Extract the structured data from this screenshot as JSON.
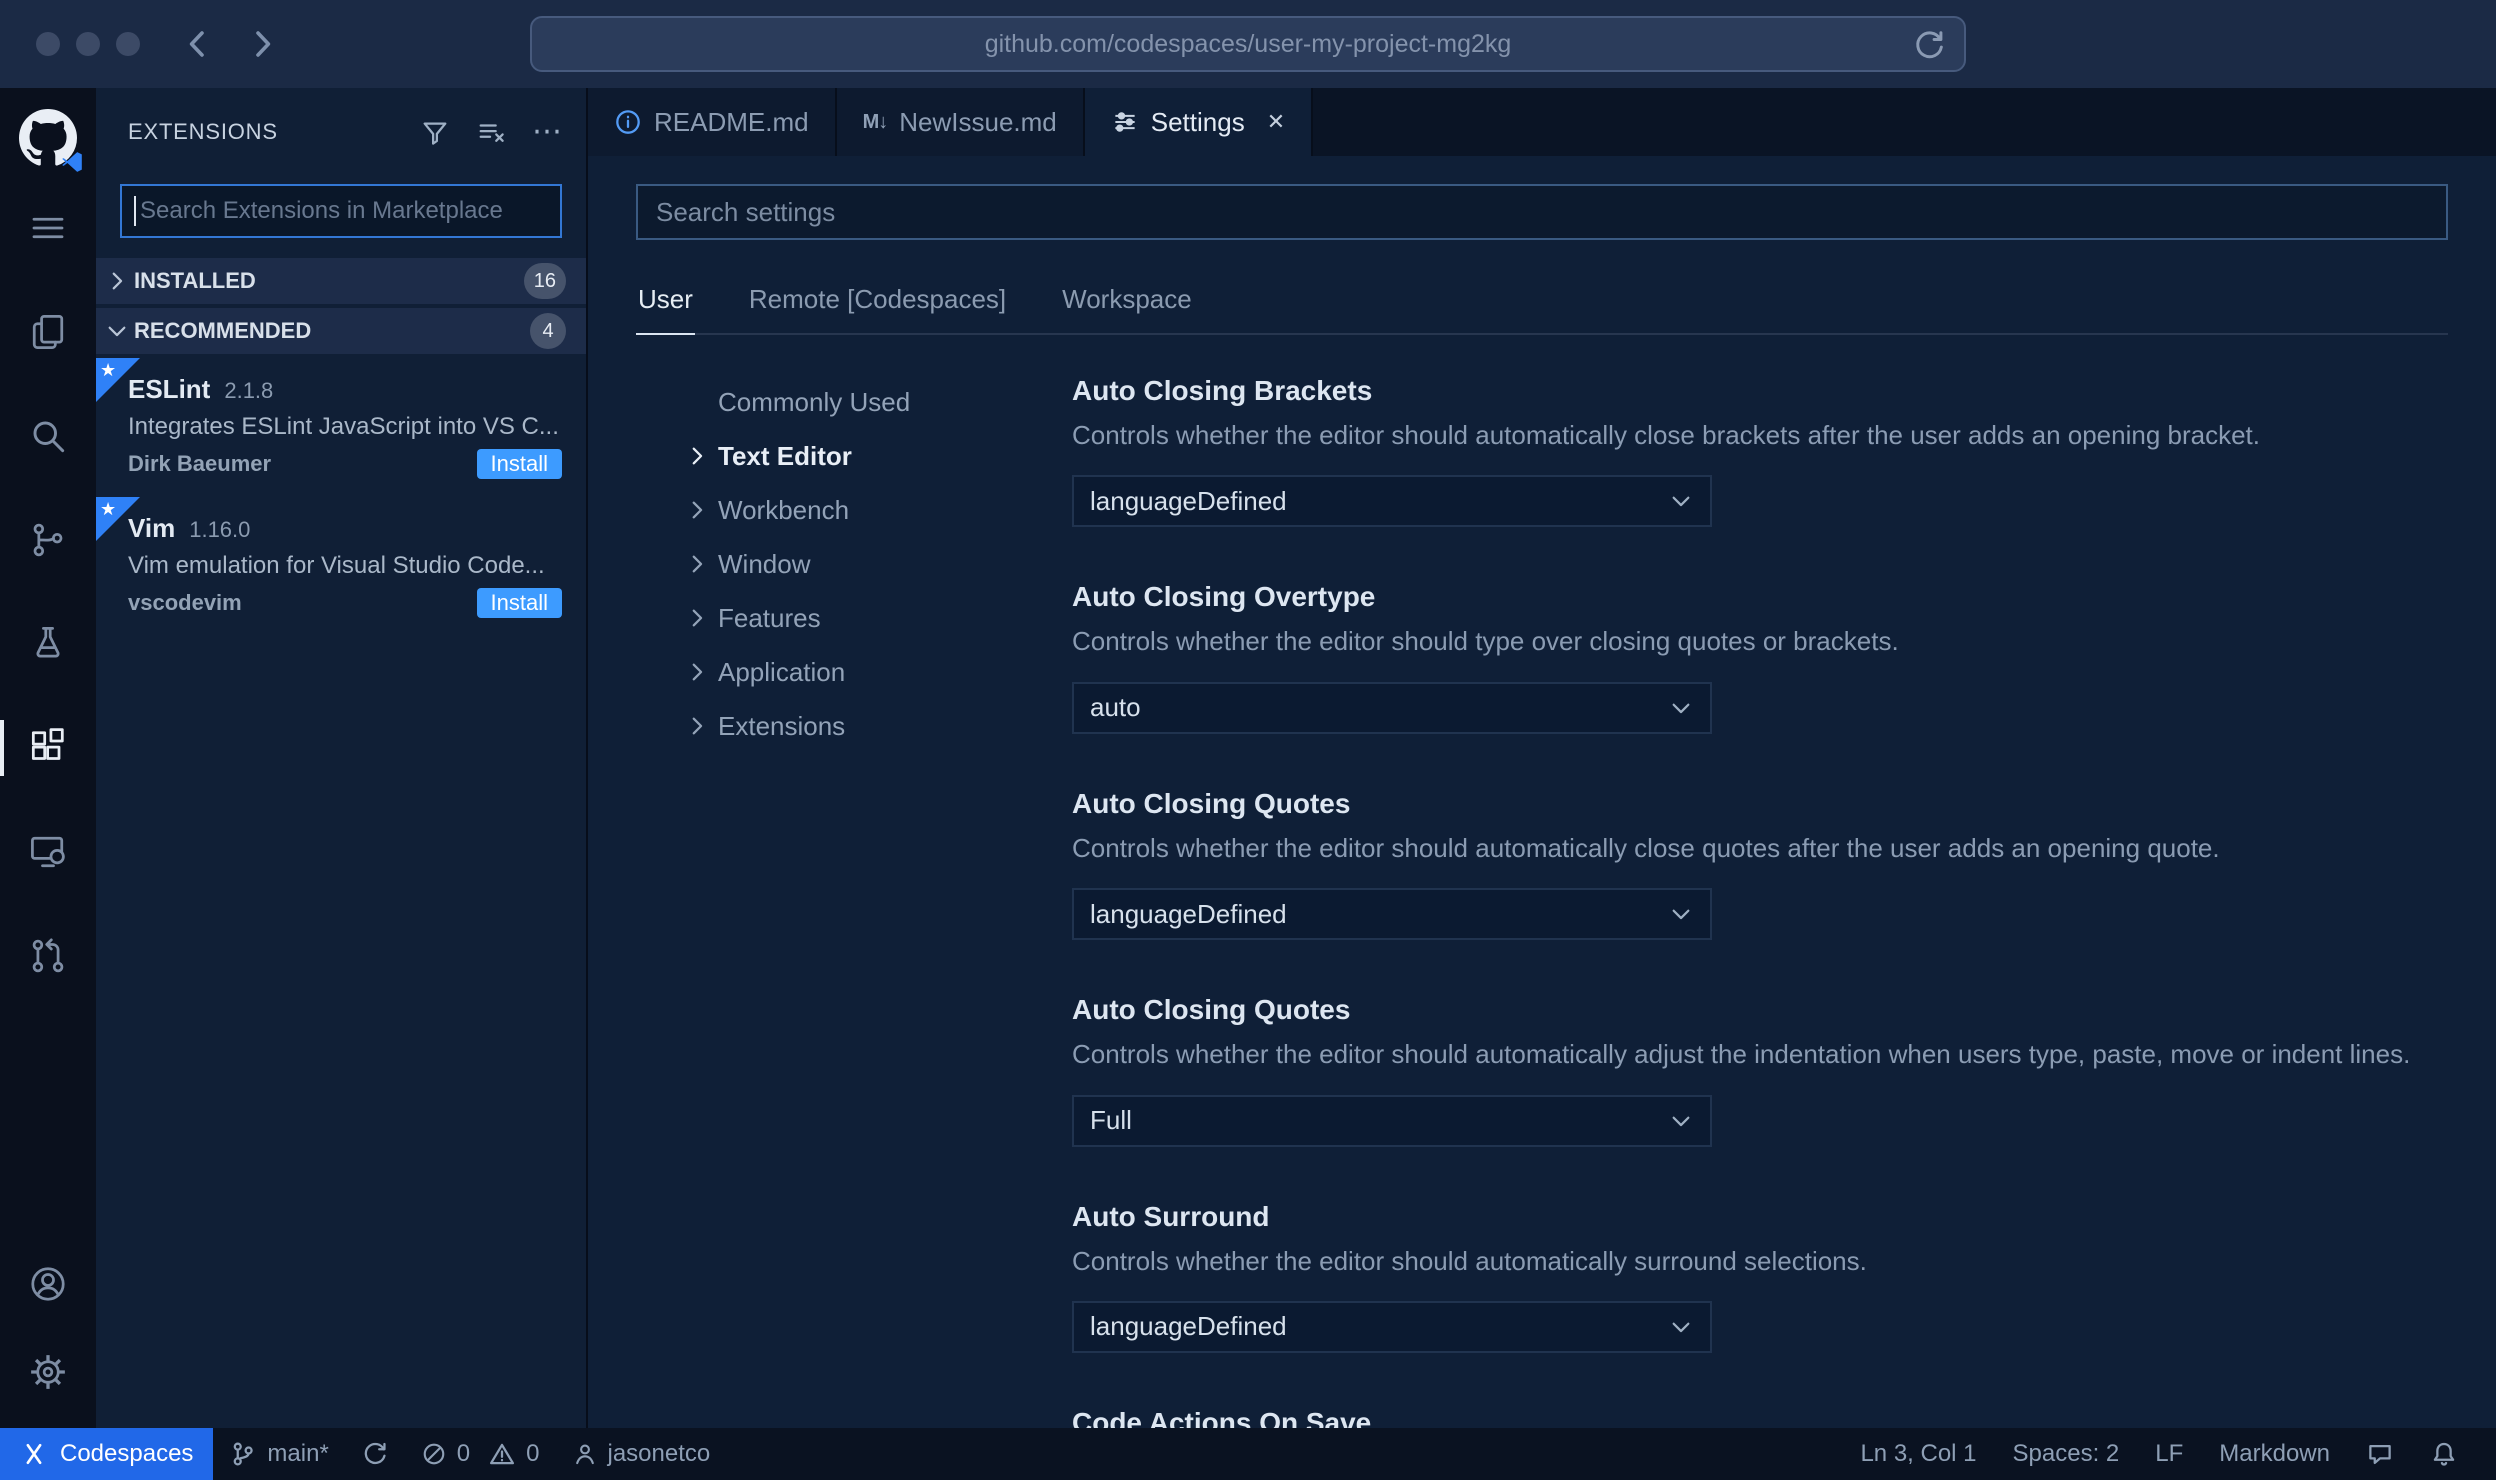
{
  "browser": {
    "url": "github.com/codespaces/user-my-project-mg2kg"
  },
  "icons": {
    "ellipsis": "⋯",
    "close": "✕",
    "star": "★",
    "markdown": "M↓"
  },
  "sidebar": {
    "title": "EXTENSIONS",
    "search_placeholder": "Search Extensions in Marketplace",
    "sections": [
      {
        "label": "INSTALLED",
        "count": "16"
      },
      {
        "label": "RECOMMENDED",
        "count": "4"
      }
    ],
    "extensions": [
      {
        "name": "ESLint",
        "version": "2.1.8",
        "description": "Integrates ESLint JavaScript into VS C...",
        "author": "Dirk Baeumer",
        "action": "Install"
      },
      {
        "name": "Vim",
        "version": "1.16.0",
        "description": "Vim emulation for Visual Studio Code...",
        "author": "vscodevim",
        "action": "Install"
      }
    ]
  },
  "tabs": [
    {
      "label": "README.md"
    },
    {
      "label": "NewIssue.md"
    },
    {
      "label": "Settings"
    }
  ],
  "settings": {
    "search_placeholder": "Search settings",
    "scopes": [
      "User",
      "Remote [Codespaces]",
      "Workspace"
    ],
    "toc": [
      "Commonly Used",
      "Text Editor",
      "Workbench",
      "Window",
      "Features",
      "Application",
      "Extensions"
    ],
    "items": [
      {
        "title": "Auto Closing Brackets",
        "description": "Controls whether the editor should automatically close brackets after the user adds an opening bracket.",
        "value": "languageDefined"
      },
      {
        "title": "Auto Closing Overtype",
        "description": "Controls whether the editor should type over closing quotes or brackets.",
        "value": "auto"
      },
      {
        "title": "Auto Closing Quotes",
        "description": "Controls whether the editor should automatically close quotes after the user adds an opening quote.",
        "value": "languageDefined"
      },
      {
        "title": "Auto Closing Quotes",
        "description": "Controls whether the editor should automatically adjust the indentation when users type, paste, move or indent lines.",
        "value": "Full"
      },
      {
        "title": "Auto Surround",
        "description": "Controls whether the editor should automatically surround selections.",
        "value": "languageDefined"
      },
      {
        "title": "Code Actions On Save",
        "description": "",
        "value": ""
      }
    ]
  },
  "status_bar": {
    "codespaces": "Codespaces",
    "branch": "main*",
    "errors": "0",
    "warnings": "0",
    "user": "jasonetco",
    "line_col": "Ln 3, Col 1",
    "indent": "Spaces: 2",
    "eol": "LF",
    "language": "Markdown"
  }
}
